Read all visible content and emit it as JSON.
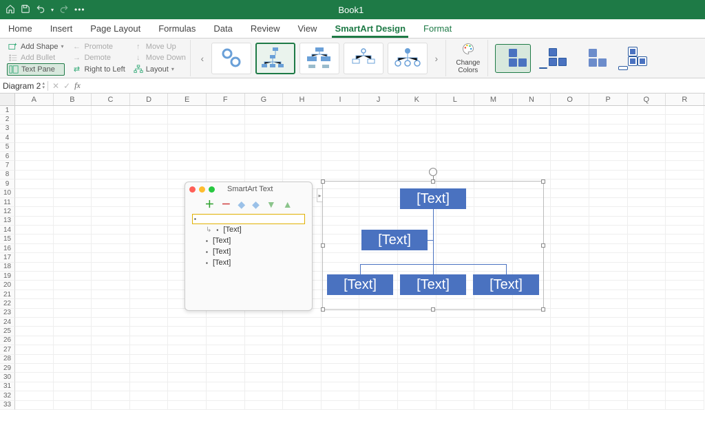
{
  "titlebar": {
    "document": "Book1"
  },
  "tabs": {
    "items": [
      "Home",
      "Insert",
      "Page Layout",
      "Formulas",
      "Data",
      "Review",
      "View",
      "SmartArt Design",
      "Format"
    ],
    "active": "SmartArt Design"
  },
  "ribbon": {
    "create": {
      "add_shape": "Add Shape",
      "add_bullet": "Add Bullet",
      "text_pane": "Text Pane",
      "promote": "Promote",
      "demote": "Demote",
      "right_to_left": "Right to Left",
      "move_up": "Move Up",
      "move_down": "Move Down",
      "layout": "Layout"
    },
    "change_colors": "Change Colors"
  },
  "namebox": "Diagram 2",
  "columns": [
    "A",
    "B",
    "C",
    "D",
    "E",
    "F",
    "G",
    "H",
    "I",
    "J",
    "K",
    "L",
    "M",
    "N",
    "O",
    "P",
    "Q",
    "R"
  ],
  "row_count": 33,
  "textpane": {
    "title": "SmartArt Text",
    "items": [
      {
        "level": 1,
        "text": "",
        "selected": true
      },
      {
        "level": 2,
        "text": "[Text]",
        "first_child": true
      },
      {
        "level": 2,
        "text": "[Text]"
      },
      {
        "level": 2,
        "text": "[Text]"
      },
      {
        "level": 2,
        "text": "[Text]"
      }
    ]
  },
  "smartart": {
    "placeholder": "[Text]"
  }
}
